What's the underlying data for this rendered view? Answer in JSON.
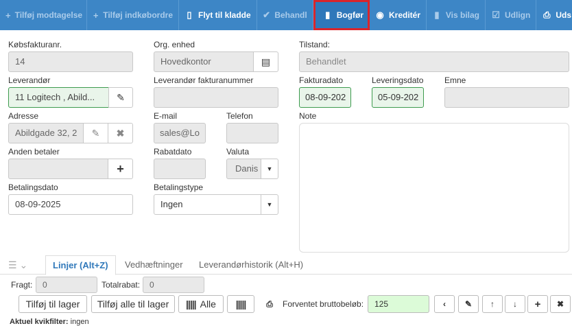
{
  "toolbar": {
    "add_receipt": "Tilføj modtagelse",
    "add_purchase_order": "Tilføj indkøbordre",
    "move_to_draft": "Flyt til kladde",
    "processed": "Behandl",
    "post": "Bogfør",
    "credit": "Kreditér",
    "show_voucher": "Vis bilag",
    "settle": "Udlign",
    "print": "Uds"
  },
  "form": {
    "invoice_no_label": "Købsfakturanr.",
    "invoice_no": "14",
    "org_unit_label": "Org. enhed",
    "org_unit": "Hovedkontor",
    "state_label": "Tilstand:",
    "state": "Behandlet",
    "supplier_label": "Leverandør",
    "supplier": "11 Logitech , Abild...",
    "supplier_invoice_label": "Leverandør fakturanummer",
    "supplier_invoice": "",
    "invoice_date_label": "Fakturadato",
    "invoice_date": "08-09-202",
    "delivery_date_label": "Leveringsdato",
    "delivery_date": "05-09-202",
    "subject_label": "Emne",
    "subject": "",
    "address_label": "Adresse",
    "address": "Abildgade 32, 2",
    "email_label": "E-mail",
    "email": "sales@Lo",
    "phone_label": "Telefon",
    "phone": "",
    "note_label": "Note",
    "other_payer_label": "Anden betaler",
    "other_payer": "",
    "discount_date_label": "Rabatdato",
    "discount_date": "",
    "currency_label": "Valuta",
    "currency": "Danis",
    "payment_date_label": "Betalingsdato",
    "payment_date": "08-09-2025",
    "payment_type_label": "Betalingstype",
    "payment_type": "Ingen"
  },
  "tabs": {
    "lines": "Linjer (Alt+Z)",
    "attachments": "Vedhæftninger",
    "supplier_history": "Leverandørhistorik (Alt+H)"
  },
  "lines": {
    "freight_label": "Fragt:",
    "freight": "0",
    "total_discount_label": "Totalrabat:",
    "total_discount": "0",
    "add_to_stock": "Tilføj til lager",
    "add_all_to_stock": "Tilføj alle til lager",
    "all": "Alle",
    "expected_gross_label": "Forventet bruttobeløb:",
    "expected_gross": "125",
    "quick_filter_label": "Aktuel kvikfilter:",
    "quick_filter": "ingen"
  }
}
